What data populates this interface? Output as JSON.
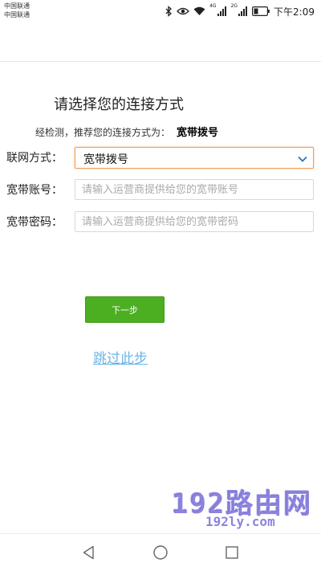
{
  "status_bar": {
    "carrier1": "中国联通",
    "carrier2": "中国联通",
    "net1": "4G",
    "net2": "2G",
    "time": "下午2:09",
    "icons": [
      "bluetooth-icon",
      "eye-icon",
      "wifi-icon",
      "signal-icon",
      "signal-icon",
      "battery-icon"
    ]
  },
  "page": {
    "title": "请选择您的连接方式",
    "recommend_prefix": "经检测，推荐您的连接方式为：",
    "recommend_value": "宽带拨号"
  },
  "form": {
    "connection_label": "联网方式：",
    "connection_value": "宽带拨号",
    "account_label": "宽带账号：",
    "account_placeholder": "请输入运营商提供给您的宽带账号",
    "password_label": "宽带密码：",
    "password_placeholder": "请输入运营商提供给您的宽带密码"
  },
  "actions": {
    "next_label": "下一步",
    "skip_label": "跳过此步"
  },
  "watermark": {
    "main": "192路由网",
    "sub": "192ly.com"
  },
  "nav_bar": {
    "icons": [
      "back-icon",
      "home-icon",
      "recents-icon"
    ]
  },
  "colors": {
    "accent_green": "#4cae21",
    "link_blue": "#6ab3e6",
    "focus_orange": "#f0a050",
    "watermark_purple": "#786ed7"
  }
}
